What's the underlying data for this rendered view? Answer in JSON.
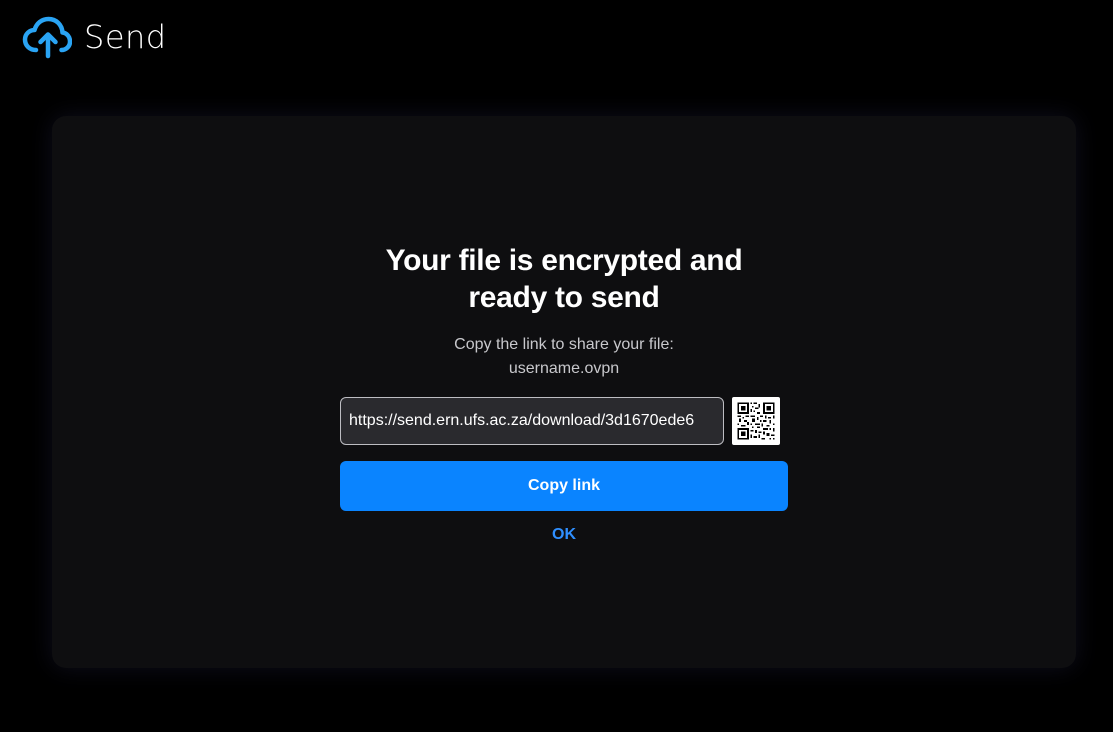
{
  "app": {
    "name": "Send",
    "logo_icon": "cloud-upload-icon",
    "accent_color": "#0a84ff"
  },
  "dialog": {
    "title": "Your file is encrypted and ready to send",
    "subtitle": "Copy the link to share your file:",
    "filename": "username.ovpn",
    "link_value": "https://send.ern.ufs.ac.za/download/3d1670ede6",
    "qr_icon": "qr-code-icon",
    "copy_button_label": "Copy link",
    "ok_label": "OK"
  }
}
